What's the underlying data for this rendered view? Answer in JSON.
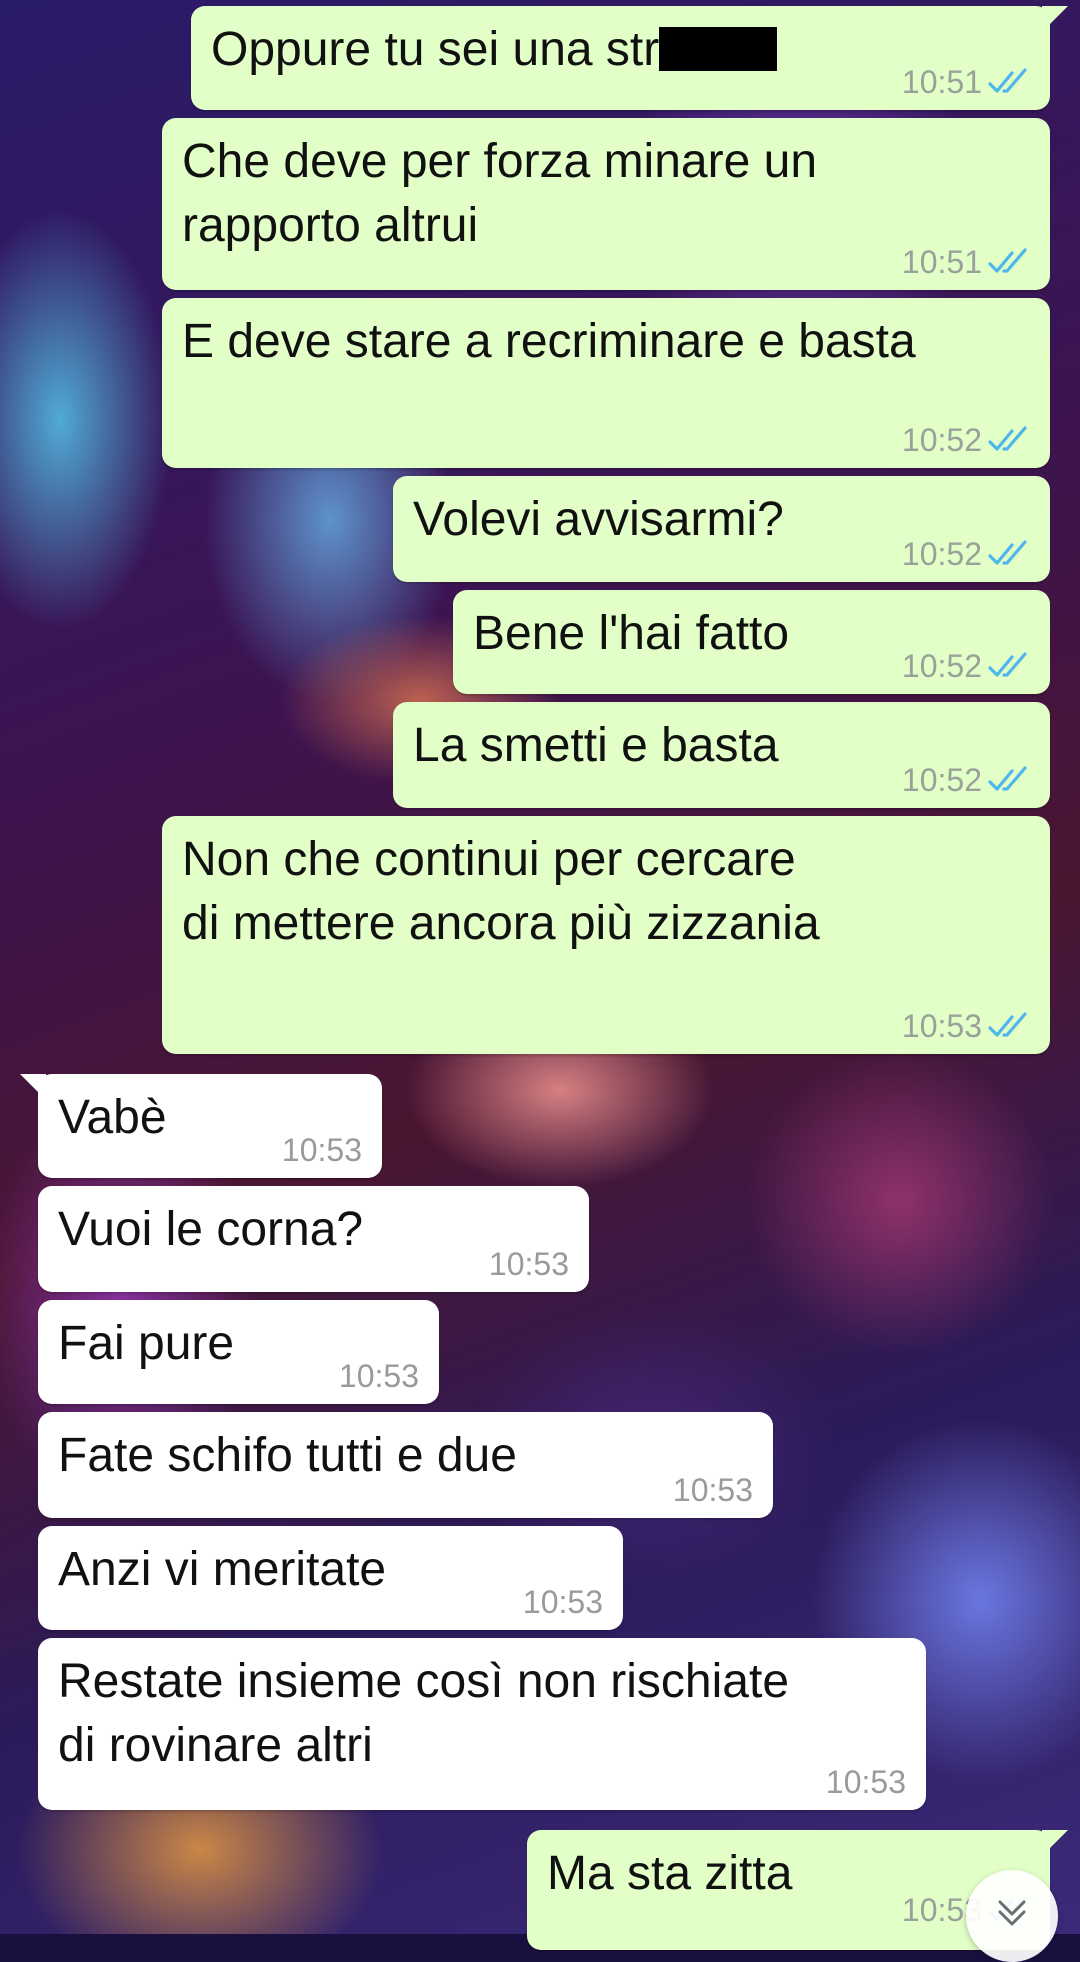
{
  "chat": {
    "messages": [
      {
        "dir": "out",
        "text": "Oppure tu sei una str",
        "time": "10:51",
        "read": true,
        "redacted": true
      },
      {
        "dir": "out",
        "text": "Che deve per forza minare un\nrapporto altrui",
        "time": "10:51",
        "read": true
      },
      {
        "dir": "out",
        "text": "E deve stare a recriminare e basta",
        "time": "10:52",
        "read": true
      },
      {
        "dir": "out",
        "text": "Volevi avvisarmi?",
        "time": "10:52",
        "read": true
      },
      {
        "dir": "out",
        "text": "Bene l'hai fatto",
        "time": "10:52",
        "read": true
      },
      {
        "dir": "out",
        "text": "La smetti e basta",
        "time": "10:52",
        "read": true
      },
      {
        "dir": "out",
        "text": "Non che continui per cercare\ndi mettere ancora più zizzania",
        "time": "10:53",
        "read": true
      },
      {
        "dir": "in",
        "text": "Vabè",
        "time": "10:53"
      },
      {
        "dir": "in",
        "text": "Vuoi le corna?",
        "time": "10:53"
      },
      {
        "dir": "in",
        "text": "Fai pure",
        "time": "10:53"
      },
      {
        "dir": "in",
        "text": "Fate schifo tutti e due",
        "time": "10:53"
      },
      {
        "dir": "in",
        "text": "Anzi vi meritate",
        "time": "10:53"
      },
      {
        "dir": "in",
        "text": "Restate insieme così non rischiate\ndi rovinare altri",
        "time": "10:53"
      },
      {
        "dir": "out",
        "text": "Ma sta zitta",
        "time": "10:53",
        "read": true
      }
    ]
  },
  "colors": {
    "outgoing_bubble": "#e2ffc7",
    "incoming_bubble": "#ffffff",
    "read_tick": "#4fb6ec",
    "timestamp": "#9aa09a"
  },
  "icons": {
    "read_receipt": "double-check-icon",
    "scroll_down": "chevron-down-icon"
  }
}
